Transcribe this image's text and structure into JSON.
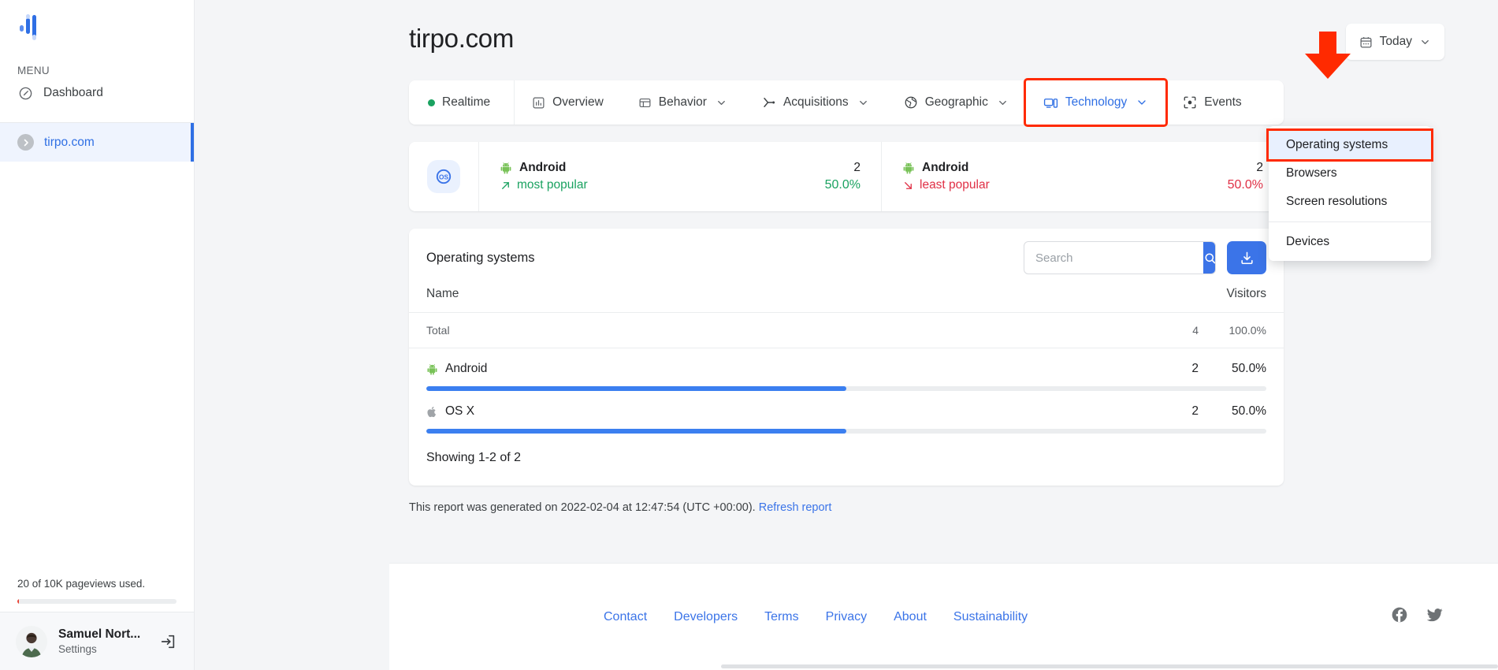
{
  "sidebar": {
    "logo_icon": "bar-chart-logo",
    "menu_label": "MENU",
    "nav": [
      {
        "label": "Dashboard",
        "icon": "gauge-icon"
      }
    ],
    "site": {
      "label": "tirpo.com",
      "icon": "chevron-right-circle-icon"
    },
    "quota": {
      "text": "20 of 10K pageviews used.",
      "percent": 0.2
    },
    "user": {
      "name": "Samuel Nort...",
      "sub": "Settings",
      "logout_icon": "logout-icon",
      "avatar": "user-avatar"
    }
  },
  "header": {
    "title": "tirpo.com",
    "date_button": {
      "label": "Today",
      "icon": "calendar-icon",
      "chevron": "chevron-down-icon"
    }
  },
  "tabs": [
    {
      "label": "Realtime",
      "icon": "green-dot-icon",
      "caret": false,
      "active": false
    },
    {
      "label": "Overview",
      "icon": "bar-chart-icon",
      "caret": false,
      "active": false
    },
    {
      "label": "Behavior",
      "icon": "window-icon",
      "caret": true,
      "active": false
    },
    {
      "label": "Acquisitions",
      "icon": "branch-icon",
      "caret": true,
      "active": false
    },
    {
      "label": "Geographic",
      "icon": "globe-icon",
      "caret": true,
      "active": false
    },
    {
      "label": "Technology",
      "icon": "monitor-icon",
      "caret": true,
      "active": true
    },
    {
      "label": "Events",
      "icon": "focus-target-icon",
      "caret": false,
      "active": false
    }
  ],
  "dropdown": {
    "items": [
      {
        "label": "Operating systems",
        "selected": true
      },
      {
        "label": "Browsers",
        "selected": false
      },
      {
        "label": "Screen resolutions",
        "selected": false
      },
      {
        "label": "Devices",
        "selected": false,
        "after_separator": true
      }
    ]
  },
  "stats": {
    "icon": "os-badge-icon",
    "cards": [
      {
        "name": "Android",
        "name_icon": "android-icon",
        "value": "2",
        "percent": "50.0%",
        "trend_label": "most popular",
        "trend_icon": "arrow-up-right-icon",
        "trend_type": "up"
      },
      {
        "name": "Android",
        "name_icon": "android-icon",
        "value": "2",
        "percent": "50.0%",
        "trend_label": "least popular",
        "trend_icon": "arrow-down-right-icon",
        "trend_type": "down"
      }
    ]
  },
  "table": {
    "title": "Operating systems",
    "search": {
      "placeholder": "Search",
      "value": "",
      "submit_icon": "search-icon"
    },
    "download": {
      "icon": "download-icon"
    },
    "columns": {
      "name": "Name",
      "visitors": "Visitors"
    },
    "total": {
      "label": "Total",
      "visitors": "4",
      "percent": "100.0%"
    },
    "rows": [
      {
        "name": "Android",
        "icon": "android-icon",
        "visitors": "2",
        "percent": "50.0%",
        "bar": 50
      },
      {
        "name": "OS X",
        "icon": "apple-icon",
        "visitors": "2",
        "percent": "50.0%",
        "bar": 50
      }
    ],
    "showing": "Showing 1-2 of 2"
  },
  "report_note": {
    "text": "This report was generated on 2022-02-04 at 12:47:54 (UTC +00:00).",
    "link": "Refresh report"
  },
  "footer": {
    "links": [
      "Contact",
      "Developers",
      "Terms",
      "Privacy",
      "About",
      "Sustainability"
    ],
    "socials": [
      {
        "name": "facebook-icon"
      },
      {
        "name": "twitter-icon"
      }
    ]
  },
  "annotation": {
    "arrow": "red-down-arrow",
    "color": "#ff2a00"
  },
  "colors": {
    "accent": "#3b74e8",
    "accent_link": "#2f6fe4",
    "bar": "#3b7ff0",
    "up": "#1aa260",
    "down": "#e02f45",
    "highlight": "#ff2a00",
    "page_bg": "#f4f5f7"
  }
}
